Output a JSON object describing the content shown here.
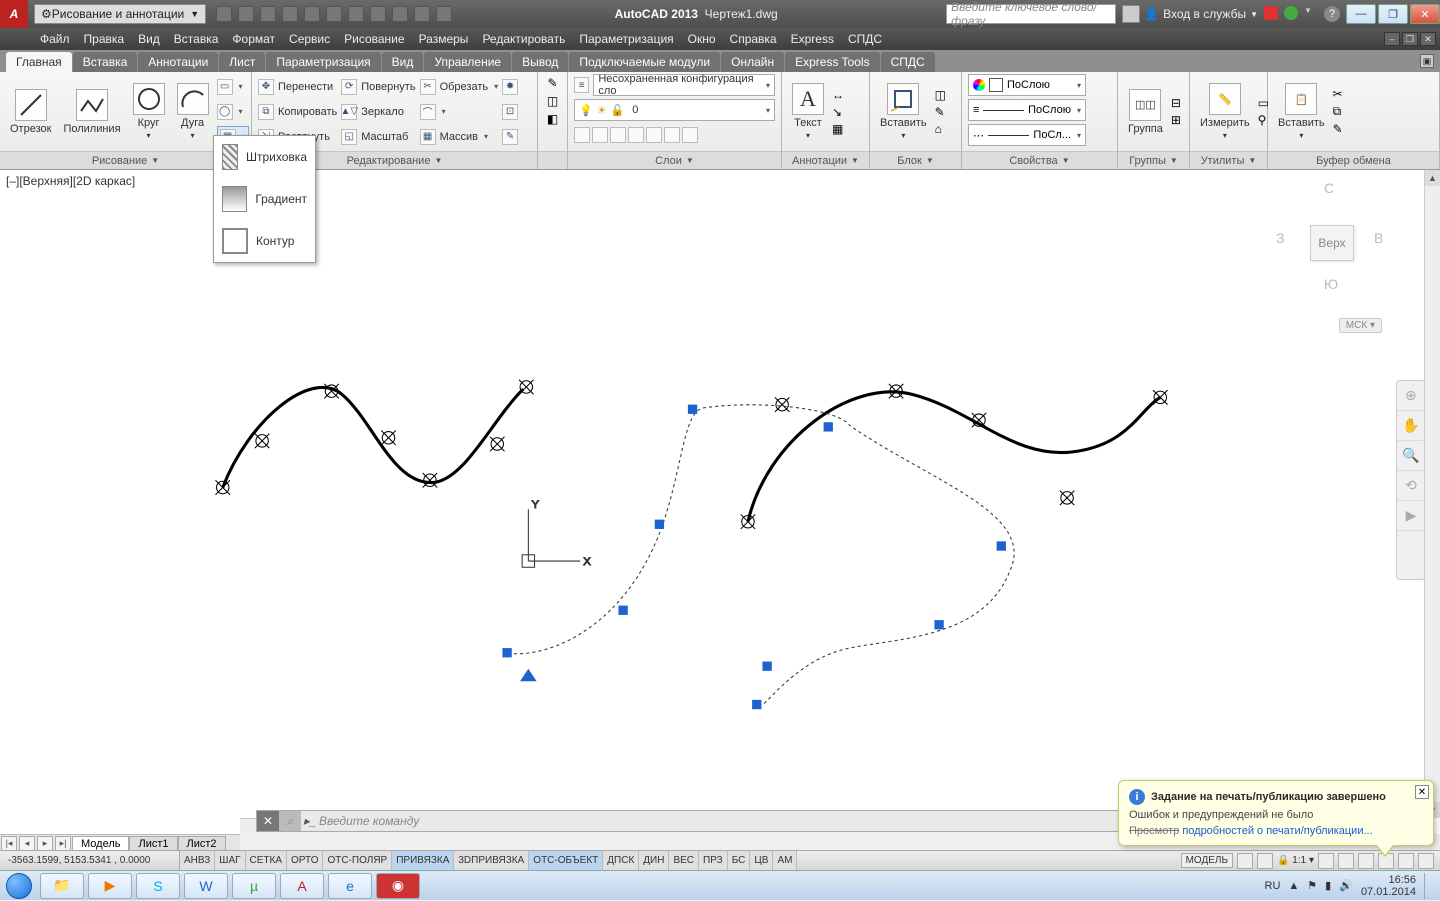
{
  "titlebar": {
    "workspace": "Рисование и аннотации",
    "app": "AutoCAD 2013",
    "doc": "Чертеж1.dwg",
    "search_placeholder": "Введите ключевое слово/фразу",
    "sign_in": "Вход в службы"
  },
  "menu": [
    "Файл",
    "Правка",
    "Вид",
    "Вставка",
    "Формат",
    "Сервис",
    "Рисование",
    "Размеры",
    "Редактировать",
    "Параметризация",
    "Окно",
    "Справка",
    "Express",
    "СПДС"
  ],
  "tabs": [
    "Главная",
    "Вставка",
    "Аннотации",
    "Лист",
    "Параметризация",
    "Вид",
    "Управление",
    "Вывод",
    "Подключаемые модули",
    "Онлайн",
    "Express Tools",
    "СПДС"
  ],
  "ribbon": {
    "draw": {
      "title": "Рисование",
      "line": "Отрезок",
      "polyline": "Полилиния",
      "circle": "Круг",
      "arc": "Дуга"
    },
    "modify": {
      "title": "Редактирование",
      "move": "Перенести",
      "copy": "Копировать",
      "stretch": "Растянуть",
      "rotate": "Повернуть",
      "mirror": "Зеркало",
      "scale": "Масштаб",
      "trim": "Обрезать",
      "array": "Массив"
    },
    "layers": {
      "title": "Слои",
      "unsaved": "Несохраненная конфигурация сло",
      "current": "0"
    },
    "annot": {
      "title": "Аннотации",
      "text": "Текст"
    },
    "block": {
      "title": "Блок",
      "insert": "Вставить"
    },
    "props": {
      "title": "Свойства",
      "bylayer1": "ПоСлою",
      "bylayer2": "ПоСлою",
      "bylayer3": "ПоСл..."
    },
    "groups": {
      "title": "Группы",
      "group": "Группа"
    },
    "utils": {
      "title": "Утилиты",
      "measure": "Измерить"
    },
    "clip": {
      "title": "Буфер обмена",
      "paste": "Вставить"
    }
  },
  "flyout": {
    "hatch": "Штриховка",
    "gradient": "Градиент",
    "boundary": "Контур"
  },
  "viewport": {
    "label": "[–][Верхняя][2D каркас]",
    "cube": {
      "n": "С",
      "s": "Ю",
      "e": "В",
      "w": "З",
      "top": "Верх"
    },
    "wcs": "МСК"
  },
  "cmd": {
    "placeholder": "Введите команду"
  },
  "layouts": {
    "model": "Модель",
    "l1": "Лист1",
    "l2": "Лист2"
  },
  "status": {
    "coords": "-3563.1599, 5153.5341 , 0.0000",
    "toggles": [
      "АНВЗ",
      "ШАГ",
      "СЕТКА",
      "ОРТО",
      "ОТС-ПОЛЯР",
      "ПРИВЯЗКА",
      "3DПРИВЯЗКА",
      "ОТС-ОБЪЕКТ",
      "ДПСК",
      "ДИН",
      "ВЕС",
      "ПРЗ",
      "БС",
      "ЦВ",
      "АМ"
    ],
    "toggles_on": [
      5,
      7
    ],
    "model_btn": "МОДЕЛЬ",
    "scale": "1:1"
  },
  "balloon": {
    "title": "Задание на печать/публикацию завершено",
    "line1": "Ошибок и предупреждений не было",
    "link_a": "Просмотр",
    "link_b": "подробностей о печати/публикации..."
  },
  "tray": {
    "lang": "RU",
    "time": "16:56",
    "date": "07.01.2014"
  }
}
